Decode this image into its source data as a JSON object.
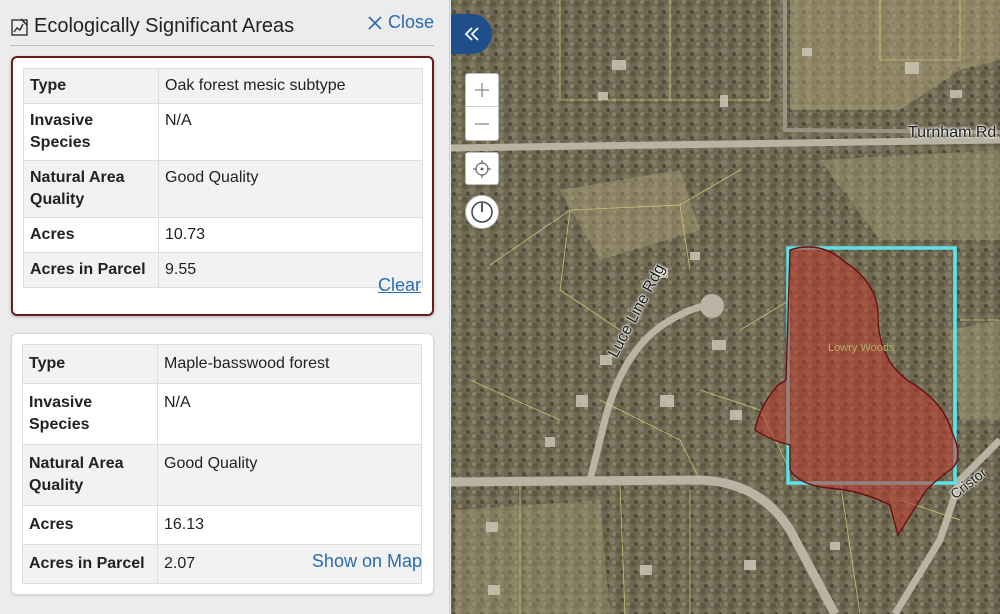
{
  "panel": {
    "title": "Ecologically Significant Areas",
    "close_label": "Close",
    "title_icon": "chart-edit-icon"
  },
  "cards": [
    {
      "rows": [
        {
          "label": "Type",
          "value": "Oak forest mesic subtype"
        },
        {
          "label": "Invasive Species",
          "value": "N/A"
        },
        {
          "label": "Natural Area Quality",
          "value": "Good Quality"
        },
        {
          "label": "Acres",
          "value": "10.73"
        },
        {
          "label": "Acres in Parcel",
          "value": "9.55"
        }
      ],
      "action_label": "Clear"
    },
    {
      "rows": [
        {
          "label": "Type",
          "value": "Maple-basswood forest"
        },
        {
          "label": "Invasive Species",
          "value": "N/A"
        },
        {
          "label": "Natural Area Quality",
          "value": "Good Quality"
        },
        {
          "label": "Acres",
          "value": "16.13"
        },
        {
          "label": "Acres in Parcel",
          "value": "2.07"
        }
      ],
      "action_label": "Show on Map"
    }
  ],
  "map": {
    "labels": {
      "road_1": "Turnham Rd",
      "road_2": "Luce Line Rdg",
      "road_3": "Cristor",
      "area": "Lowry Woods"
    },
    "controls": {
      "collapse": "double-chevron-left-icon",
      "zoom_in": "plus-icon",
      "zoom_out": "minus-icon",
      "locate": "crosshair-icon",
      "compass": "compass-icon"
    },
    "colors": {
      "selected_parcel_outline": "#5ce1e6",
      "esa_fill": "#c0392b",
      "esa_outline": "#6b1010",
      "collapse_bg": "#1f4f8a",
      "link": "#2a6ab0",
      "selected_card_border": "#6b1d1d"
    }
  }
}
